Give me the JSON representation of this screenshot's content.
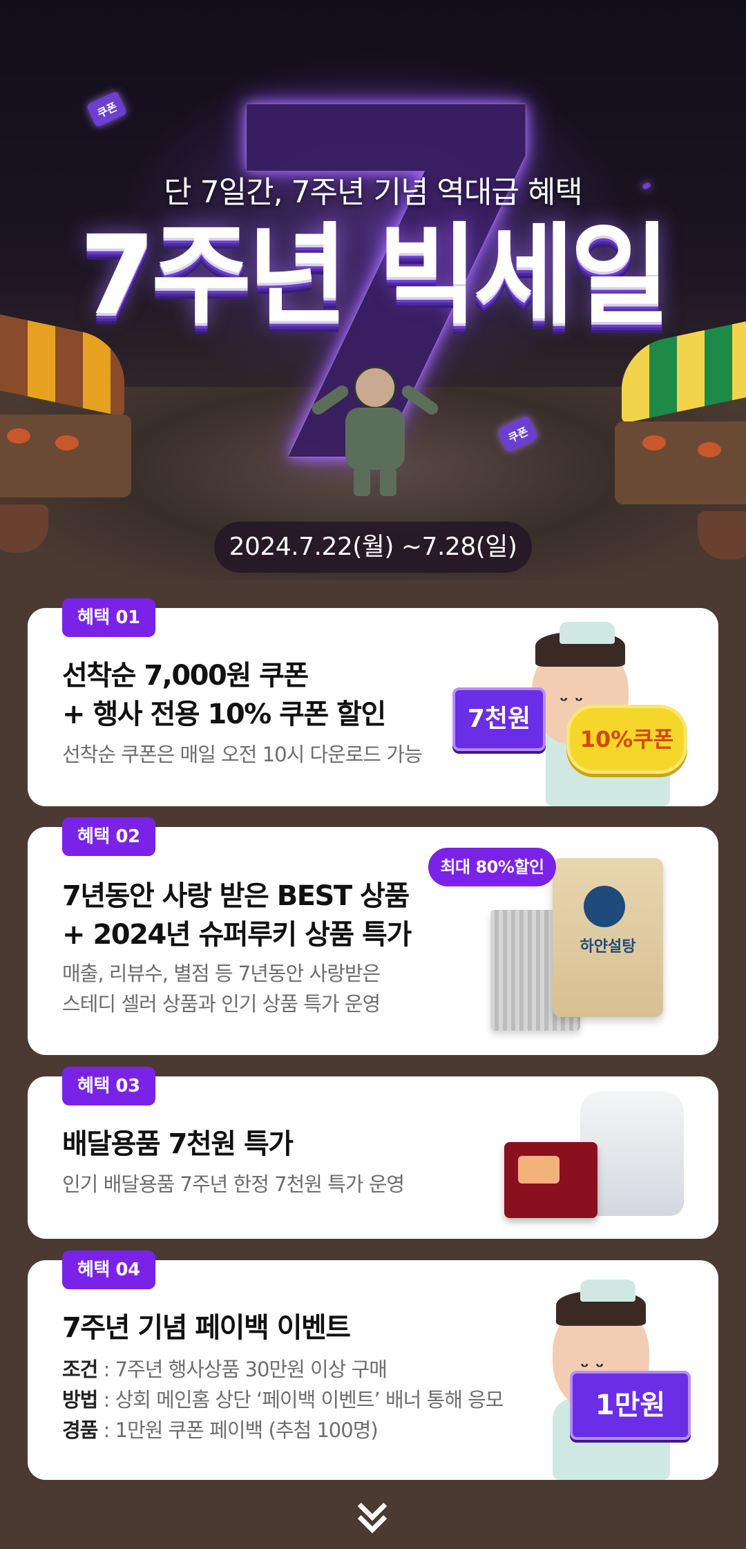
{
  "hero": {
    "subtitle": "단 7일간, 7주년 기념 역대급 혜택",
    "title": "7주년 빅세일",
    "big_numeral": "7",
    "date_range": "2024.7.22(월) ~7.28(일)",
    "floating_coupon_label": "쿠폰"
  },
  "benefits": [
    {
      "badge": "혜택 01",
      "title_line1": "선착순 7,000원 쿠폰",
      "title_line2": "+ 행사 전용 10% 쿠폰 할인",
      "desc_line1": "선착순 쿠폰은 매일 오전 10시 다운로드 가능",
      "ticket_label": "7천원",
      "coupon_label": "10%쿠폰"
    },
    {
      "badge": "혜택 02",
      "title_line1": "7년동안 사랑 받은 BEST 상품",
      "title_line2": "+ 2024년 슈퍼루키 상품 특가",
      "desc_line1": "매출, 리뷰수, 별점 등 7년동안 사랑받은",
      "desc_line2": "스테디 셀러 상품과 인기 상품 특가 운영",
      "speech_label": "최대 80%할인",
      "product_name": "하얀설탕"
    },
    {
      "badge": "혜택 03",
      "title_line1": "배달용품 7천원 특가",
      "desc_line1": "인기 배달용품 7주년 한정 7천원 특가 운영"
    },
    {
      "badge": "혜택 04",
      "title_line1": "7주년 기념 페이백 이벤트",
      "rows": [
        {
          "key": "조건",
          "value": " : 7주년 행사상품 30만원 이상 구매"
        },
        {
          "key": "방법",
          "value": " : 상회 메인홈 상단 ‘페이백 이벤트’ 배너 통해 응모"
        },
        {
          "key": "경품",
          "value": " : 1만원 쿠폰 페이백 (추첨 100명)"
        }
      ],
      "ticket_label": "1만원"
    }
  ],
  "colors": {
    "badge": "#7b22e8",
    "page_bg": "#4a3a31",
    "card_bg": "#ffffff"
  },
  "icons": {
    "scroll_more": "double-chevron-down-icon"
  }
}
